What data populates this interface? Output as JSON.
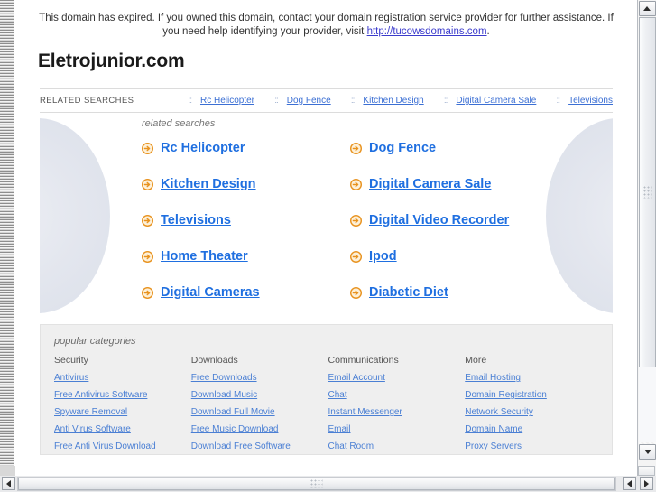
{
  "notice": {
    "text_before": "This domain has expired. If you owned this domain, contact your domain registration service provider for further assistance. If you need help identifying your provider, visit ",
    "link_text": "http://tucowsdomains.com",
    "text_after": "."
  },
  "domain_title": "Eletrojunior.com",
  "related_bar": {
    "label": "RELATED SEARCHES",
    "separator": "::",
    "links": [
      "Rc Helicopter",
      "Dog Fence",
      "Kitchen Design",
      "Digital Camera Sale",
      "Televisions"
    ]
  },
  "searches": {
    "caption": "related searches",
    "items": [
      "Rc Helicopter",
      "Dog Fence",
      "Kitchen Design",
      "Digital Camera Sale",
      "Televisions",
      "Digital Video Recorder",
      "Home Theater",
      "Ipod",
      "Digital Cameras",
      "Diabetic Diet"
    ],
    "arrow_icon": "arrow-circle-right-icon"
  },
  "categories": {
    "caption": "popular categories",
    "columns": [
      {
        "heading": "Security",
        "links": [
          "Antivirus",
          "Free Antivirus Software",
          "Spyware Removal",
          "Anti Virus Software",
          "Free Anti Virus Download"
        ]
      },
      {
        "heading": "Downloads",
        "links": [
          "Free Downloads",
          "Download Music",
          "Download Full Movie",
          "Free Music Download",
          "Download Free Software"
        ]
      },
      {
        "heading": "Communications",
        "links": [
          "Email Account",
          "Chat",
          "Instant Messenger",
          "Email",
          "Chat Room"
        ]
      },
      {
        "heading": "More",
        "links": [
          "Email Hosting",
          "Domain Registration",
          "Network Security",
          "Domain Name",
          "Proxy Servers"
        ]
      }
    ]
  },
  "colors": {
    "link_blue": "#1f6fe0",
    "bar_link_blue": "#3b6fd4",
    "notice_link": "#3b3bcc",
    "arrow_orange": "#e8921e",
    "panel_grey": "#efefef"
  },
  "scrollbars": {
    "vertical_up_icon": "triangle-up-icon",
    "vertical_down_icon": "triangle-down-icon",
    "horizontal_left_icon": "triangle-left-icon",
    "horizontal_right_icon": "triangle-right-icon"
  }
}
